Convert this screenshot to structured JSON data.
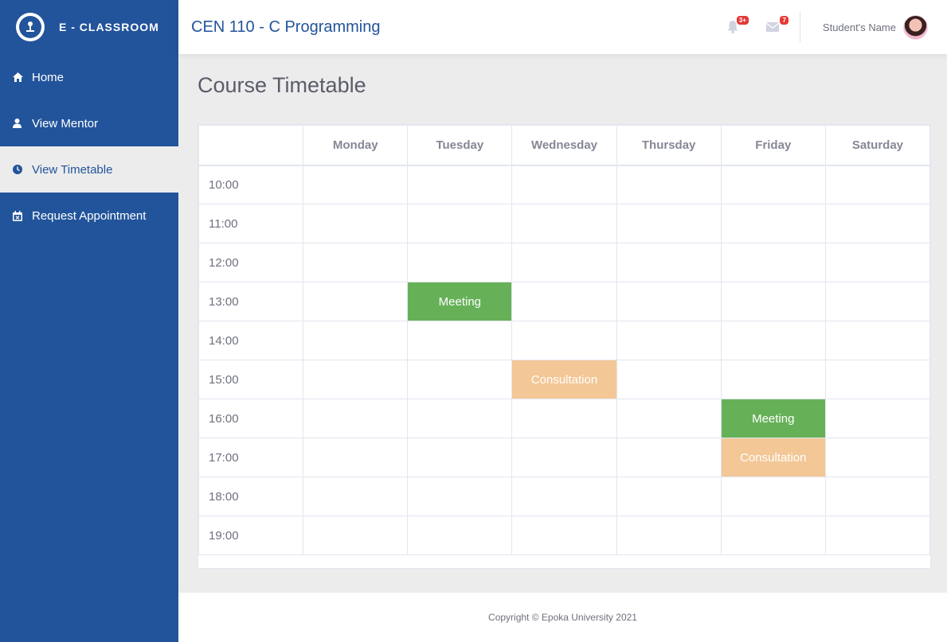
{
  "sidebar": {
    "brand": "E - CLASSROOM",
    "items": [
      {
        "label": "Home",
        "icon": "home-icon"
      },
      {
        "label": "View Mentor",
        "icon": "user-icon"
      },
      {
        "label": "View Timetable",
        "icon": "clock-icon"
      },
      {
        "label": "Request Appointment",
        "icon": "calendar-icon"
      }
    ],
    "active_index": 2
  },
  "header": {
    "course_title": "CEN 110 - C Programming",
    "alerts_badge": "3+",
    "messages_badge": "7",
    "user_name": "Student's Name"
  },
  "page_title": "Course Timetable",
  "timetable": {
    "days": [
      "Monday",
      "Tuesday",
      "Wednesday",
      "Thursday",
      "Friday",
      "Saturday"
    ],
    "times": [
      "10:00",
      "11:00",
      "12:00",
      "13:00",
      "14:00",
      "15:00",
      "16:00",
      "17:00",
      "18:00",
      "19:00"
    ],
    "events": [
      {
        "time": "13:00",
        "day": "Tuesday",
        "label": "Meeting",
        "type": "meeting"
      },
      {
        "time": "15:00",
        "day": "Wednesday",
        "label": "Consultation",
        "type": "consultation"
      },
      {
        "time": "16:00",
        "day": "Friday",
        "label": "Meeting",
        "type": "meeting"
      },
      {
        "time": "17:00",
        "day": "Friday",
        "label": "Consultation",
        "type": "consultation"
      }
    ]
  },
  "colors": {
    "primary": "#22549b",
    "meeting": "#66b158",
    "consultation": "#f3c796",
    "badge": "#e53935"
  },
  "footer": {
    "copyright": "Copyright © Epoka University 2021"
  }
}
